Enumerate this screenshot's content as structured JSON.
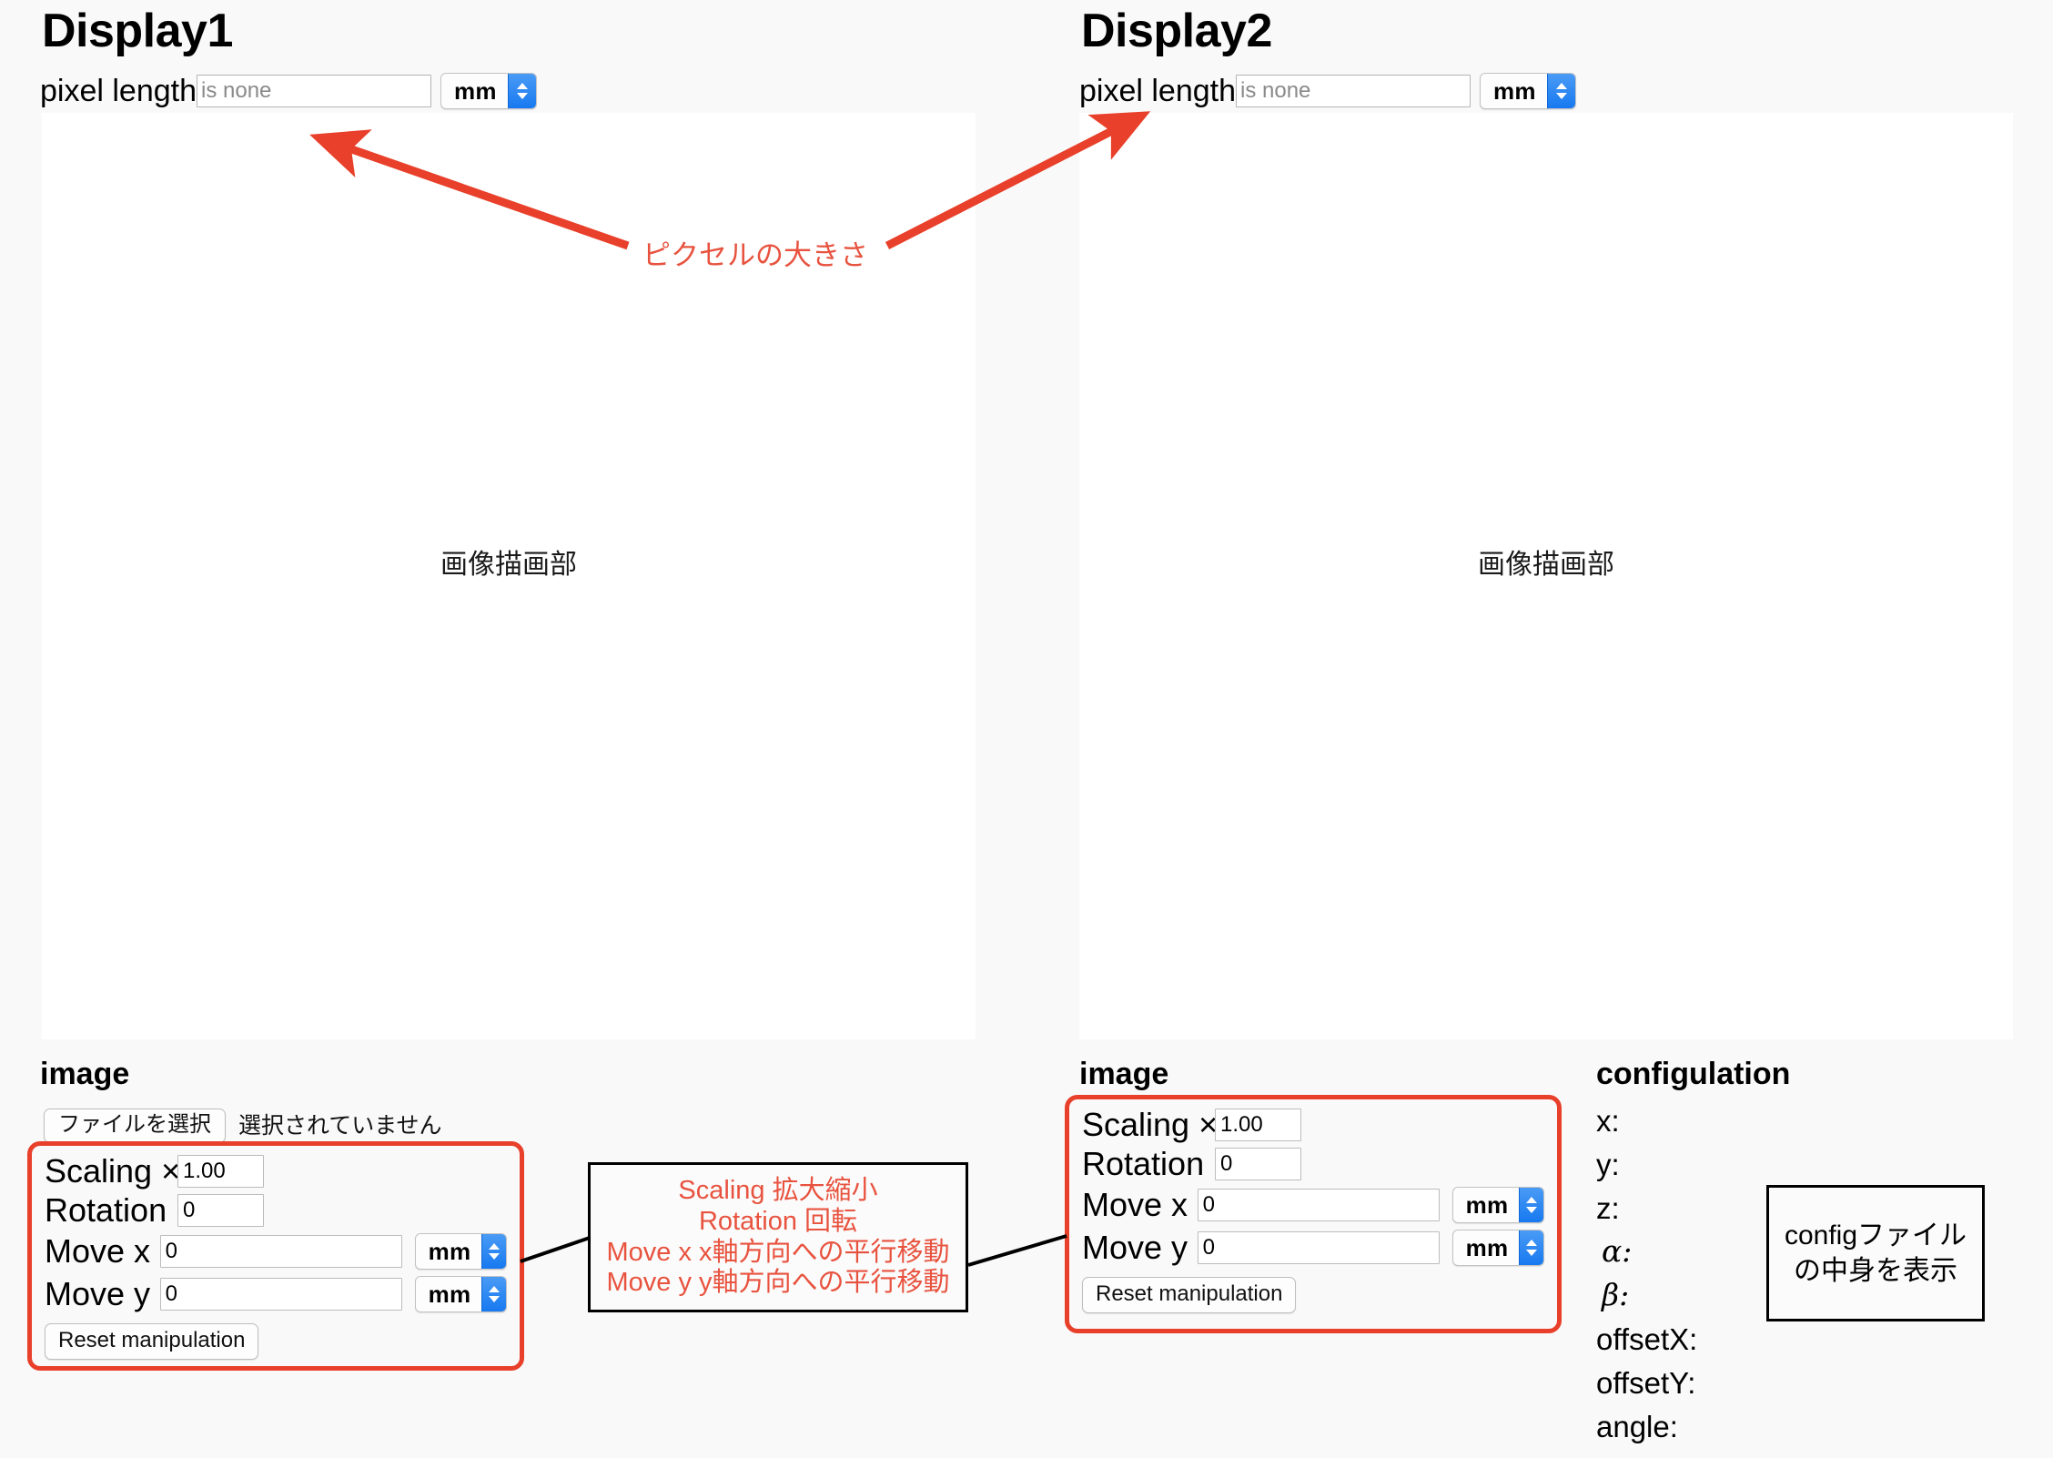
{
  "displays": [
    {
      "title": "Display1",
      "pixel_length": {
        "label": "pixel length",
        "value": "",
        "placeholder": "is none",
        "unit": "mm"
      },
      "canvas_label": "画像描画部"
    },
    {
      "title": "Display2",
      "pixel_length": {
        "label": "pixel length",
        "value": "",
        "placeholder": "is none",
        "unit": "mm"
      },
      "canvas_label": "画像描画部"
    }
  ],
  "image_panels": [
    {
      "heading": "image",
      "file_button": "ファイルを選択",
      "file_status": "選択されていません",
      "scaling_label": "Scaling ×",
      "scaling_value": "1.00",
      "rotation_label": "Rotation",
      "rotation_value": "0",
      "move_x_label": "Move x",
      "move_x_value": "0",
      "move_x_unit": "mm",
      "move_y_label": "Move y",
      "move_y_value": "0",
      "move_y_unit": "mm",
      "reset_label": "Reset manipulation"
    },
    {
      "heading": "image",
      "scaling_label": "Scaling ×",
      "scaling_value": "1.00",
      "rotation_label": "Rotation",
      "rotation_value": "0",
      "move_x_label": "Move x",
      "move_x_value": "0",
      "move_x_unit": "mm",
      "move_y_label": "Move y",
      "move_y_value": "0",
      "move_y_unit": "mm",
      "reset_label": "Reset manipulation"
    }
  ],
  "configuration": {
    "heading": "configulation",
    "items": [
      {
        "label": "x:"
      },
      {
        "label": "y:"
      },
      {
        "label": "z:"
      },
      {
        "label": "α:"
      },
      {
        "label": "β:"
      },
      {
        "label": "offsetX:"
      },
      {
        "label": "offsetY:"
      },
      {
        "label": "angle:"
      }
    ]
  },
  "annotations": {
    "pixel_size_text": "ピクセルの大きさ",
    "manipulation_note": {
      "lines": [
        "Scaling 拡大縮小",
        "Rotation 回転",
        "Move x x軸方向への平行移動",
        "Move y y軸方向への平行移動"
      ]
    },
    "config_note": {
      "lines": [
        "configファイル",
        "の中身を表示"
      ]
    }
  },
  "colors": {
    "annotation_red": "#E8402A",
    "annotation_red_text": "#E8533F",
    "page_background": "#f9f9f9",
    "canvas_background": "#ffffff",
    "select_accent": "#1779f0"
  }
}
